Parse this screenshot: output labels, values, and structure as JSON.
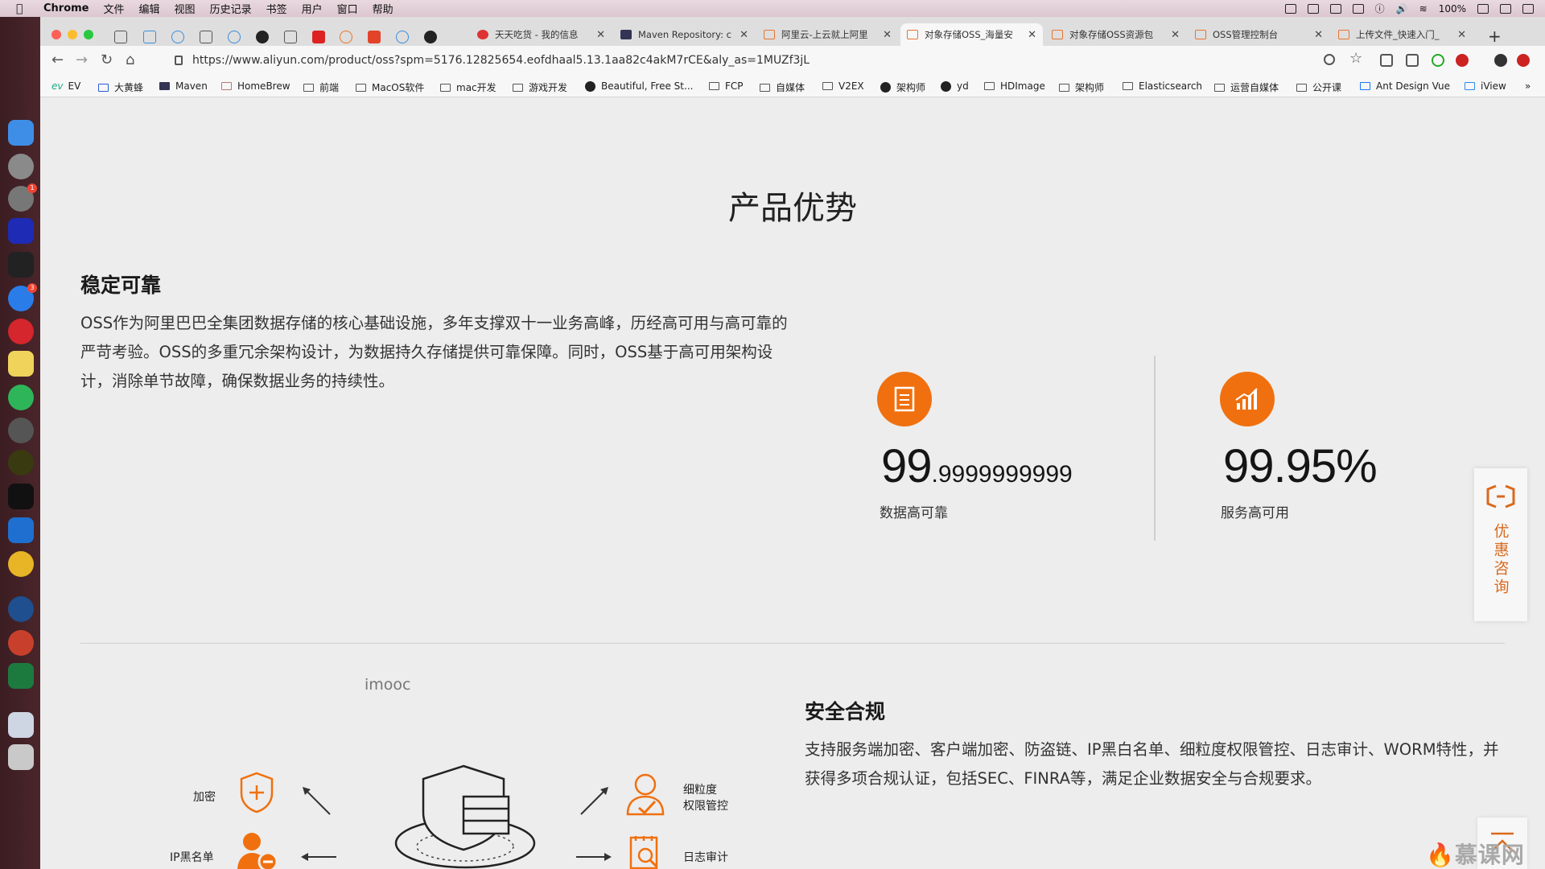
{
  "menubar": {
    "app": "Chrome",
    "items": [
      "文件",
      "编辑",
      "视图",
      "历史记录",
      "书签",
      "用户",
      "窗口",
      "帮助"
    ],
    "battery": "100%"
  },
  "tabs": [
    {
      "title": "天天吃货 - 我的信息",
      "icon": "red-dot-icon"
    },
    {
      "title": "Maven Repository: c",
      "icon": "maven-icon"
    },
    {
      "title": "阿里云-上云就上阿里",
      "icon": "aliyun-icon"
    },
    {
      "title": "对象存储OSS_海量安",
      "icon": "aliyun-icon",
      "active": true
    },
    {
      "title": "对象存储OSS资源包",
      "icon": "aliyun-icon"
    },
    {
      "title": "OSS管理控制台",
      "icon": "aliyun-icon"
    },
    {
      "title": "上传文件_快速入门_",
      "icon": "aliyun-icon"
    }
  ],
  "address": {
    "url": "https://www.aliyun.com/product/oss?spm=5176.12825654.eofdhaal5.13.1aa82c4akM7rCE&aly_as=1MUZf3jL"
  },
  "bookmarks": [
    "EV",
    "大黄蜂",
    "Maven",
    "HomeBrew",
    "前端",
    "MacOS软件",
    "mac开发",
    "游戏开发",
    "Beautiful, Free St...",
    "FCP",
    "自媒体",
    "V2EX",
    "架构师",
    "yd",
    "HDImage",
    "架构师",
    "Elasticsearch",
    "运营自媒体",
    "公开课",
    "Ant Design Vue",
    "iView"
  ],
  "page": {
    "section_title": "产品优势",
    "stable": {
      "heading": "稳定可靠",
      "body": "OSS作为阿里巴巴全集团数据存储的核心基础设施，多年支撑双十一业务高峰，历经高可用与高可靠的严苛考验。OSS的多重冗余架构设计，为数据持久存储提供可靠保障。同时，OSS基于高可用架构设计，消除单节故障，确保数据业务的持续性。"
    },
    "stats": [
      {
        "big": "99",
        "small": ".9999999999",
        "label": "数据高可靠",
        "icon": "document-icon"
      },
      {
        "big": "99.95%",
        "small": "",
        "label": "服务高可用",
        "icon": "bar-chart-icon"
      }
    ],
    "watermark": "imooc",
    "security": {
      "heading": "安全合规",
      "body": "支持服务端加密、客户端加密、防盗链、IP黑白名单、细粒度权限管控、日志审计、WORM特性，并获得多项合规认证，包括SEC、FINRA等，满足企业数据安全与合规要求。"
    },
    "diagram": {
      "encrypt": "加密",
      "blacklist": "IP黑名单",
      "fine_grain_1": "细粒度",
      "fine_grain_2": "权限管控",
      "log_audit": "日志审计"
    },
    "consult": "优惠咨询",
    "brand_watermark": "慕课网"
  },
  "colors": {
    "accent": "#f0700f",
    "consult_text": "#d9691c"
  }
}
